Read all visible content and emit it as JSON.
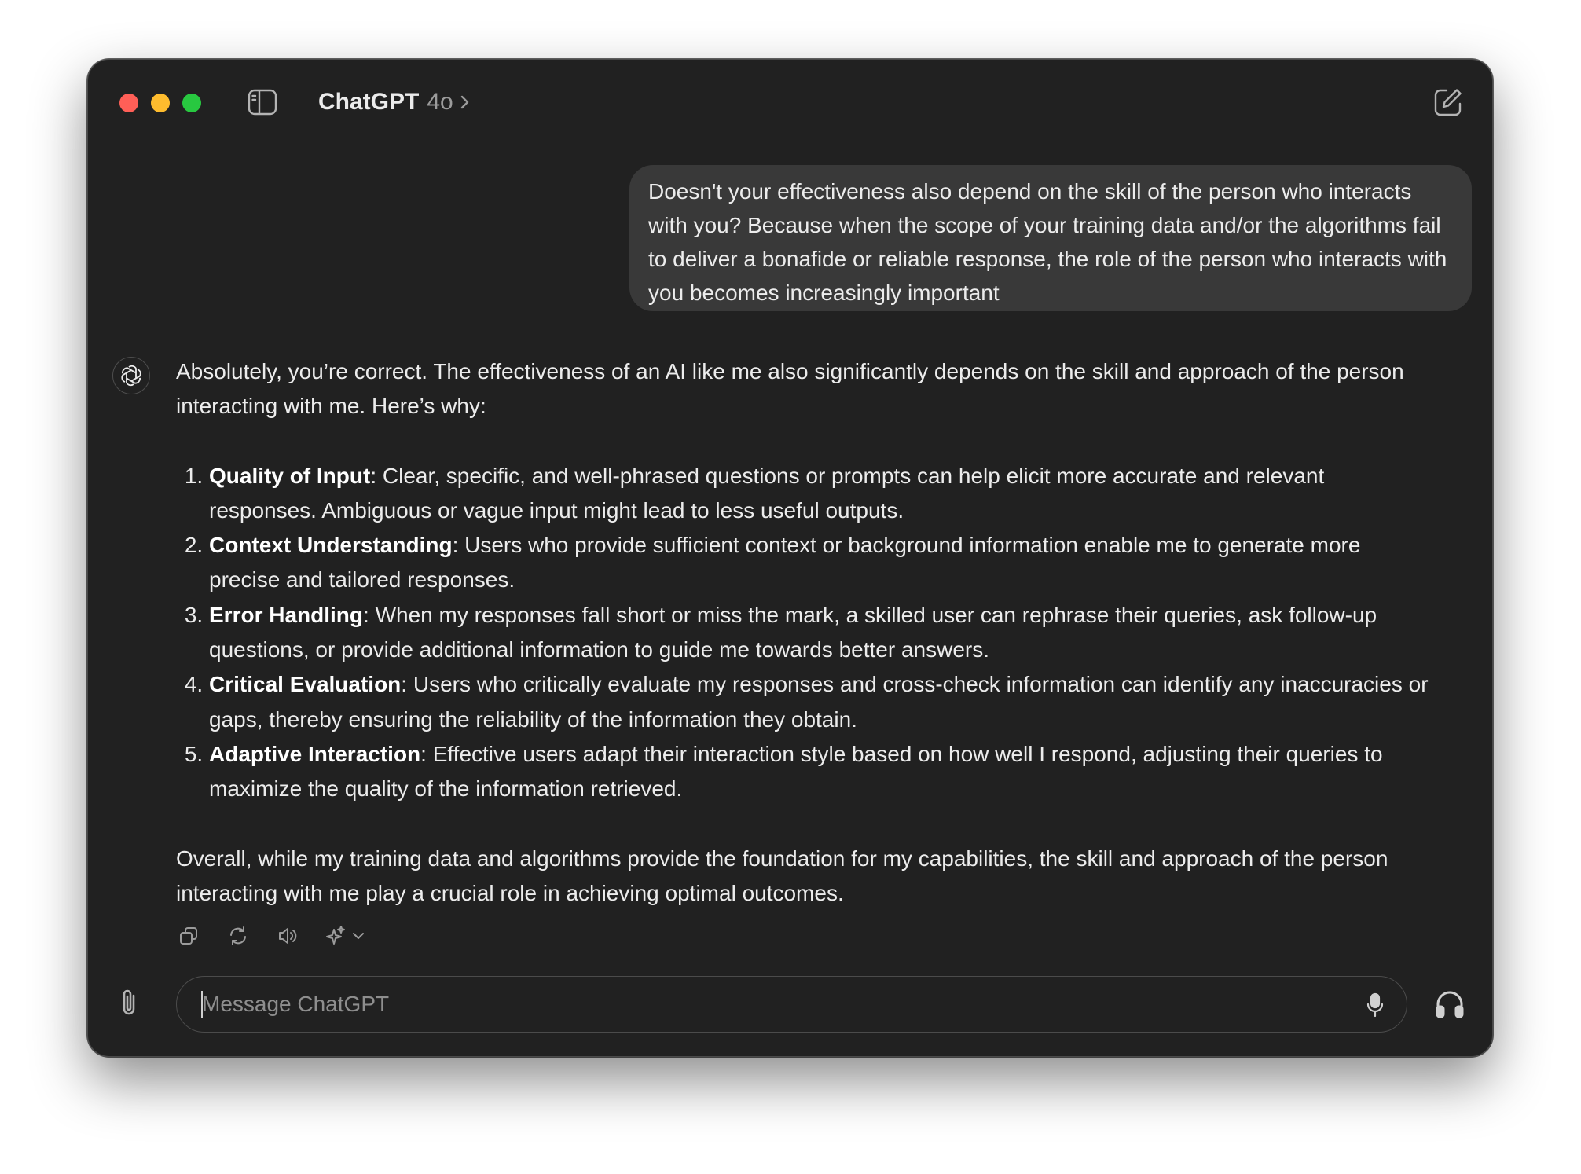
{
  "window": {
    "app_name": "ChatGPT",
    "model": "4o"
  },
  "user_message": "Doesn't your effectiveness also depend on the skill of the person who interacts with you? Because when the scope of your training data and/or the algorithms fail to deliver a bonafide or reliable response, the role of the person who interacts with you becomes increasingly important",
  "assistant_message": {
    "intro": "Absolutely, you’re correct. The effectiveness of an AI like me also significantly depends on the skill and approach of the person interacting with me. Here’s why:",
    "items": [
      {
        "title": "Quality of Input",
        "text": ": Clear, specific, and well-phrased questions or prompts can help elicit more accurate and relevant responses. Ambiguous or vague input might lead to less useful outputs."
      },
      {
        "title": "Context Understanding",
        "text": ": Users who provide sufficient context or background information enable me to generate more precise and tailored responses."
      },
      {
        "title": "Error Handling",
        "text": ": When my responses fall short or miss the mark, a skilled user can rephrase their queries, ask follow-up questions, or provide additional information to guide me towards better answers."
      },
      {
        "title": "Critical Evaluation",
        "text": ": Users who critically evaluate my responses and cross-check information can identify any inaccuracies or gaps, thereby ensuring the reliability of the information they obtain."
      },
      {
        "title": "Adaptive Interaction",
        "text": ": Effective users adapt their interaction style based on how well I respond, adjusting their queries to maximize the quality of the information retrieved."
      }
    ],
    "conclusion": "Overall, while my training data and algorithms provide the foundation for my capabilities, the skill and approach of the person interacting with me play a crucial role in achieving optimal outcomes."
  },
  "message_actions": [
    "copy-icon",
    "regenerate-icon",
    "read-aloud-icon",
    "sparkle-icon"
  ],
  "composer": {
    "placeholder": "Message ChatGPT"
  },
  "icons": {
    "sidebar_toggle": "sidebar-icon",
    "new_chat": "compose-icon",
    "attach": "paperclip-icon",
    "mic": "microphone-icon",
    "voice_mode": "headphones-icon"
  },
  "colors": {
    "window_bg": "#212121",
    "user_bubble": "#393939",
    "traffic_red": "#ff5f57",
    "traffic_yellow": "#febc2e",
    "traffic_green": "#28c840"
  }
}
